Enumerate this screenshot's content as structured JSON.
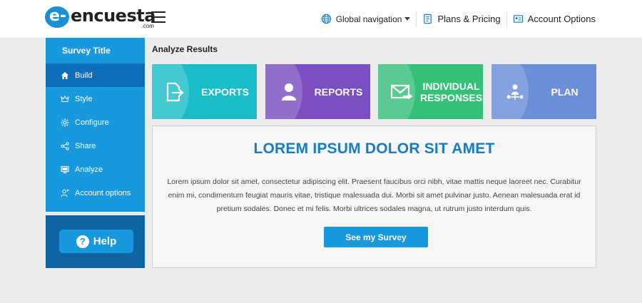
{
  "header": {
    "logo_badge": "e-",
    "logo_main": "encuesta",
    "logo_sub": ".com",
    "nav": {
      "global": "Global navigation",
      "plans": "Plans & Pricing",
      "account": "Account Options"
    }
  },
  "sidebar": {
    "title": "Survey Title",
    "items": [
      {
        "label": "Build",
        "icon": "home-icon",
        "active": true
      },
      {
        "label": "Style",
        "icon": "crown-icon",
        "active": false
      },
      {
        "label": "Configure",
        "icon": "gear-icon",
        "active": false
      },
      {
        "label": "Share",
        "icon": "share-icon",
        "active": false
      },
      {
        "label": "Analyze",
        "icon": "monitor-icon",
        "active": false
      },
      {
        "label": "Account options",
        "icon": "user-gear-icon",
        "active": false
      }
    ],
    "help_label": "Help",
    "help_icon": "?"
  },
  "main": {
    "section_title": "Analyze Results",
    "tiles": [
      {
        "label": "EXPORTS",
        "icon": "export-file-icon",
        "color": "#19bdc8"
      },
      {
        "label": "REPORTS",
        "icon": "person-icon",
        "color": "#7b4fc1"
      },
      {
        "label": "INDIVIDUAL RESPONSES",
        "icon": "envelope-icon",
        "color": "#35c07a"
      },
      {
        "label": "PLAN",
        "icon": "people-network-icon",
        "color": "#6b8ed9"
      }
    ],
    "card": {
      "title": "LOREM IPSUM DOLOR SIT AMET",
      "text": "Lorem ipsum dolor sit amet, consectetur adipiscing elit. Praesent faucibus orci nibh, vitae mattis neque laoreet nec. Curabitur enim mi, condimentum feugiat mauris vitae, tristique malesuada dui. Morbi sit amet pulvinar justo. Aenean malesuada erat id pretium sodales. Donec et mi felis. Morbi ultrices sodales magna, ut rutrum justo interdum quis.",
      "button": "See my Survey"
    }
  },
  "colors": {
    "brand_blue": "#1898dd",
    "active_blue": "#0f6eb9",
    "title_blue": "#1a7cc1"
  }
}
